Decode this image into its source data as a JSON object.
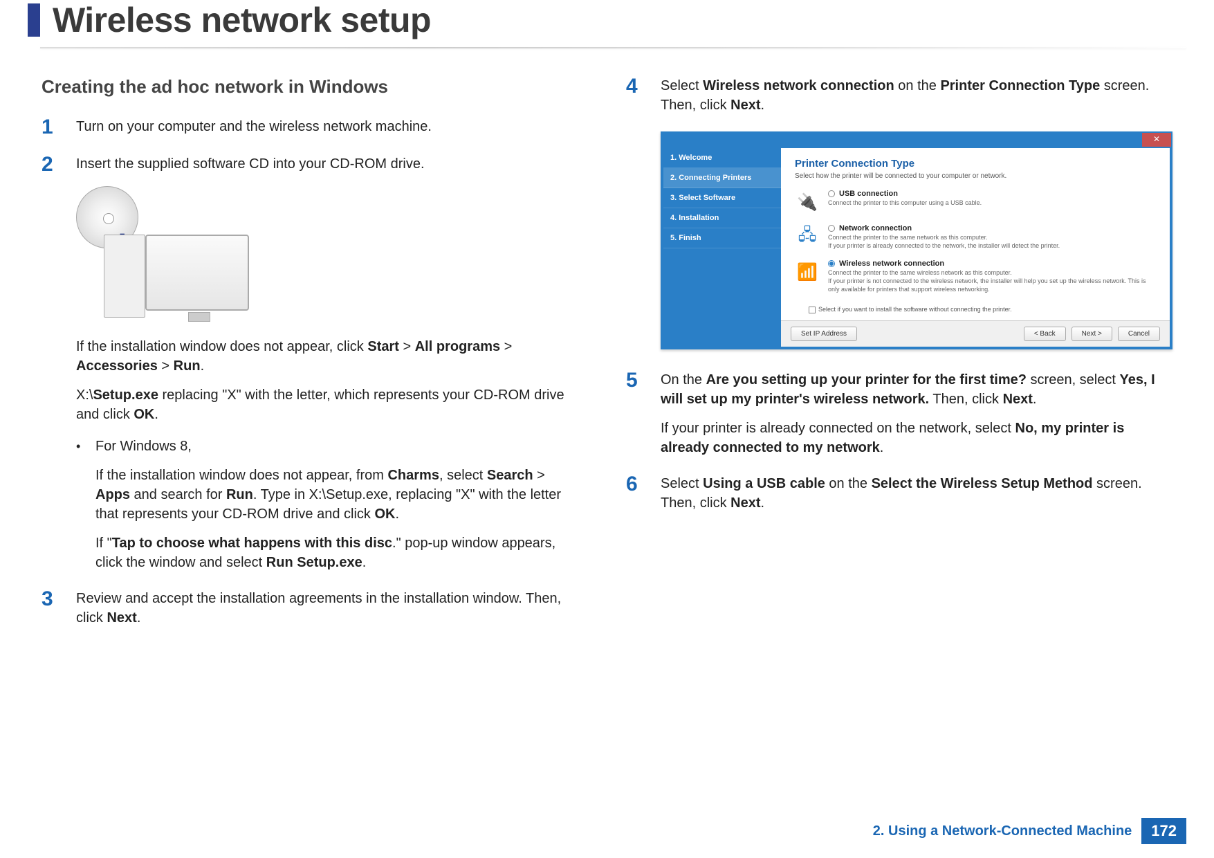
{
  "page_title": "Wireless network setup",
  "section_heading": "Creating the ad hoc network in Windows",
  "steps": {
    "s1": {
      "num": "1",
      "text": "Turn on your computer and the wireless network machine."
    },
    "s2": {
      "num": "2",
      "text": "Insert the supplied software CD into your CD-ROM drive.",
      "para1_a": "If the installation window does not appear, click ",
      "para1_b1": "Start",
      "gt1": " > ",
      "para1_b2": "All programs",
      "gt2": " > ",
      "para1_b3": "Accessories",
      "gt3": " > ",
      "para1_b4": "Run",
      "para1_end": ".",
      "para2_a": " X:\\",
      "para2_b": "Setup.exe",
      "para2_c": " replacing \"X\" with the letter, which represents your CD-ROM drive and click ",
      "para2_d": "OK",
      "para2_end": ".",
      "bullet_label": "For Windows 8,",
      "bullet_p1_a": "If the installation window does not appear, from ",
      "bullet_p1_b": "Charms",
      "bullet_p1_c": ", select ",
      "bullet_p1_d": "Search",
      "bullet_p1_e": " > ",
      "bullet_p1_f": "Apps",
      "bullet_p1_g": " and search for ",
      "bullet_p1_h": "Run",
      "bullet_p1_i": ". Type in X:\\Setup.exe, replacing \"X\" with the letter that represents your CD-ROM drive and click ",
      "bullet_p1_j": "OK",
      "bullet_p1_end": ".",
      "bullet_p2_a": "If \"",
      "bullet_p2_b": "Tap to choose what happens with this disc",
      "bullet_p2_c": ".\" pop-up window appears, click the window and select ",
      "bullet_p2_d": "Run Setup.exe",
      "bullet_p2_end": "."
    },
    "s3": {
      "num": "3",
      "text_a": "Review and accept the installation agreements in the installation window. Then, click ",
      "text_b": "Next",
      "text_end": "."
    },
    "s4": {
      "num": "4",
      "text_a": "Select ",
      "text_b": "Wireless network connection",
      "text_c": " on the ",
      "text_d": "Printer Connection Type",
      "text_e": " screen. Then, click ",
      "text_f": "Next",
      "text_end": "."
    },
    "s5": {
      "num": "5",
      "text_a": "On the ",
      "text_b": "Are you setting up your printer for the first time?",
      "text_c": " screen, select ",
      "text_d": "Yes, I will set up my printer's wireless network.",
      "text_e": " Then, click ",
      "text_f": "Next",
      "text_end": ".",
      "p2_a": "If your printer is already connected on the network, select ",
      "p2_b": "No, my printer is already connected to my network",
      "p2_end": "."
    },
    "s6": {
      "num": "6",
      "text_a": "Select ",
      "text_b": "Using a USB cable",
      "text_c": " on the ",
      "text_d": "Select the Wireless Setup Method",
      "text_e": " screen. Then, click ",
      "text_f": "Next",
      "text_end": "."
    }
  },
  "screenshot": {
    "close": "✕",
    "sidebar": [
      "1. Welcome",
      "2. Connecting Printers",
      "3. Select Software",
      "4. Installation",
      "5. Finish"
    ],
    "heading": "Printer Connection Type",
    "sub": "Select how the printer will be connected to your computer or network.",
    "opt1": {
      "title": "USB connection",
      "desc": "Connect the printer to this computer using a USB cable."
    },
    "opt2": {
      "title": "Network connection",
      "desc": "Connect the printer to the same network as this computer.\nIf your printer is already connected to the network, the installer will detect the printer."
    },
    "opt3": {
      "title": "Wireless network connection",
      "desc": "Connect the printer to the same wireless network as this computer.\nIf your printer is not connected to the wireless network, the installer will help you set up the wireless network. This is only available for printers that support wireless networking."
    },
    "checkbox": "Select if you want to install the software without connecting the printer.",
    "btn_ip": "Set IP Address",
    "btn_back": "< Back",
    "btn_next": "Next >",
    "btn_cancel": "Cancel"
  },
  "footer": {
    "chapter": "2.  Using a Network-Connected Machine",
    "page": "172"
  }
}
